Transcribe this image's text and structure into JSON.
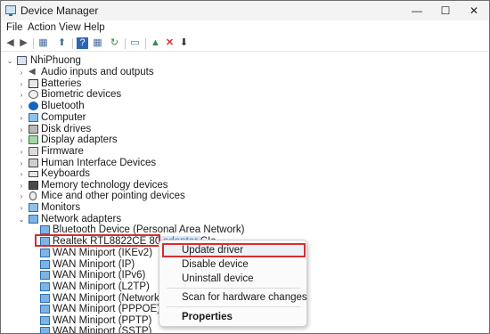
{
  "window": {
    "title": "Device Manager",
    "minimize": "—",
    "maximize": "☐",
    "close": "✕"
  },
  "menu": {
    "file": "File",
    "action": "Action",
    "view": "View",
    "help": "Help"
  },
  "toolbar": {
    "back": "◀",
    "forward": "▶",
    "properties": "▦",
    "update_driver": "⬆",
    "help": "?",
    "scan": "↻",
    "monitor": "▭",
    "enable": "▲",
    "uninstall": "✕",
    "download": "⬇"
  },
  "tree": {
    "root": "NhiPhuong",
    "categories": [
      "Audio inputs and outputs",
      "Batteries",
      "Biometric devices",
      "Bluetooth",
      "Computer",
      "Disk drives",
      "Display adapters",
      "Firmware",
      "Human Interface Devices",
      "Keyboards",
      "Memory technology devices",
      "Mice and other pointing devices",
      "Monitors",
      "Network adapters"
    ],
    "network_children": [
      "Bluetooth Device (Personal Area Network)",
      "Realtek RTL8822CE 802.11ac PCIe",
      "WAN Miniport (IKEv2)",
      "WAN Miniport (IP)",
      "WAN Miniport (IPv6)",
      "WAN Miniport (L2TP)",
      "WAN Miniport (Network Monito",
      "WAN Miniport (PPPOE)",
      "WAN Miniport (PPTP)",
      "WAN Miniport (SSTP)"
    ],
    "selected_trail": "adapter"
  },
  "context_menu": {
    "update_driver": "Update driver",
    "disable_device": "Disable device",
    "uninstall_device": "Uninstall device",
    "scan": "Scan for hardware changes",
    "properties": "Properties"
  },
  "colors": {
    "highlight_border": "#d32f2f",
    "network_icon": "#7fb3e3"
  }
}
